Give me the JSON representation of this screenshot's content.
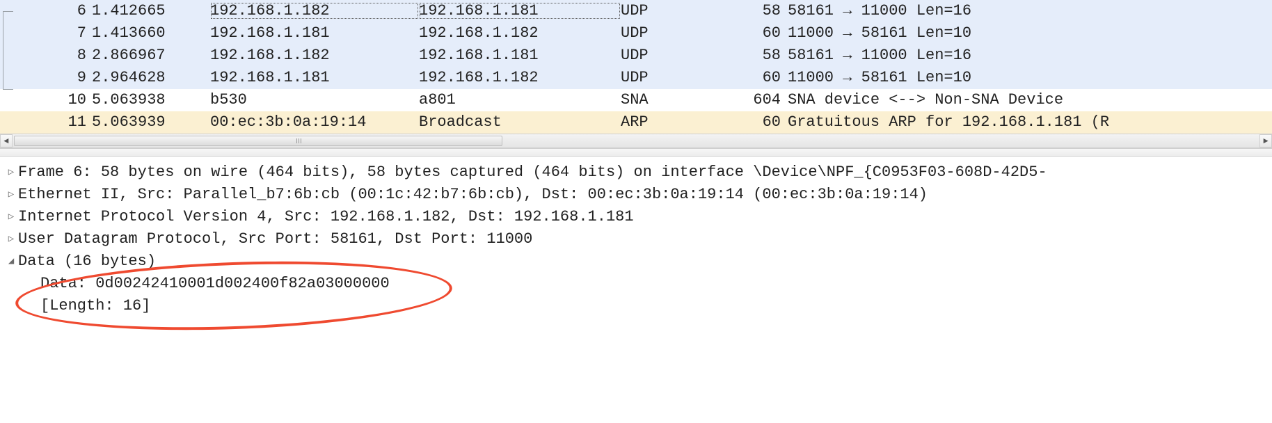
{
  "packets": [
    {
      "no": "6",
      "time": "1.412665",
      "src": "192.168.1.182",
      "dst": "192.168.1.181",
      "proto": "UDP",
      "len": "58",
      "info": "58161 → 11000 Len=16",
      "cls": "row-udp",
      "selected": true
    },
    {
      "no": "7",
      "time": "1.413660",
      "src": "192.168.1.181",
      "dst": "192.168.1.182",
      "proto": "UDP",
      "len": "60",
      "info": "11000 → 58161 Len=10",
      "cls": "row-udp",
      "selected": false
    },
    {
      "no": "8",
      "time": "2.866967",
      "src": "192.168.1.182",
      "dst": "192.168.1.181",
      "proto": "UDP",
      "len": "58",
      "info": "58161 → 11000 Len=16",
      "cls": "row-udp",
      "selected": false
    },
    {
      "no": "9",
      "time": "2.964628",
      "src": "192.168.1.181",
      "dst": "192.168.1.182",
      "proto": "UDP",
      "len": "60",
      "info": "11000 → 58161 Len=10",
      "cls": "row-udp",
      "selected": false
    },
    {
      "no": "10",
      "time": "5.063938",
      "src": "b530",
      "dst": "a801",
      "proto": "SNA",
      "len": "604",
      "info": "SNA device <--> Non-SNA Device",
      "cls": "row-sna",
      "selected": false
    },
    {
      "no": "11",
      "time": "5.063939",
      "src": "00:ec:3b:0a:19:14",
      "dst": "Broadcast",
      "proto": "ARP",
      "len": "60",
      "info": "Gratuitous ARP for 192.168.1.181 (R",
      "cls": "row-arp",
      "selected": false
    }
  ],
  "tree": {
    "frame": "Frame 6: 58 bytes on wire (464 bits), 58 bytes captured (464 bits) on interface \\Device\\NPF_{C0953F03-608D-42D5-",
    "eth": "Ethernet II, Src: Parallel_b7:6b:cb (00:1c:42:b7:6b:cb), Dst: 00:ec:3b:0a:19:14 (00:ec:3b:0a:19:14)",
    "ip": "Internet Protocol Version 4, Src: 192.168.1.182, Dst: 192.168.1.181",
    "udp": "User Datagram Protocol, Src Port: 58161, Dst Port: 11000",
    "dataHdr": "Data (16 bytes)",
    "dataHex": "Data: 0d00242410001d002400f82a03000000",
    "dataLen": "[Length: 16]"
  },
  "glyphs": {
    "tri_right": "▷",
    "tri_down": "◢",
    "arrow_left": "◄",
    "arrow_right": "►"
  }
}
